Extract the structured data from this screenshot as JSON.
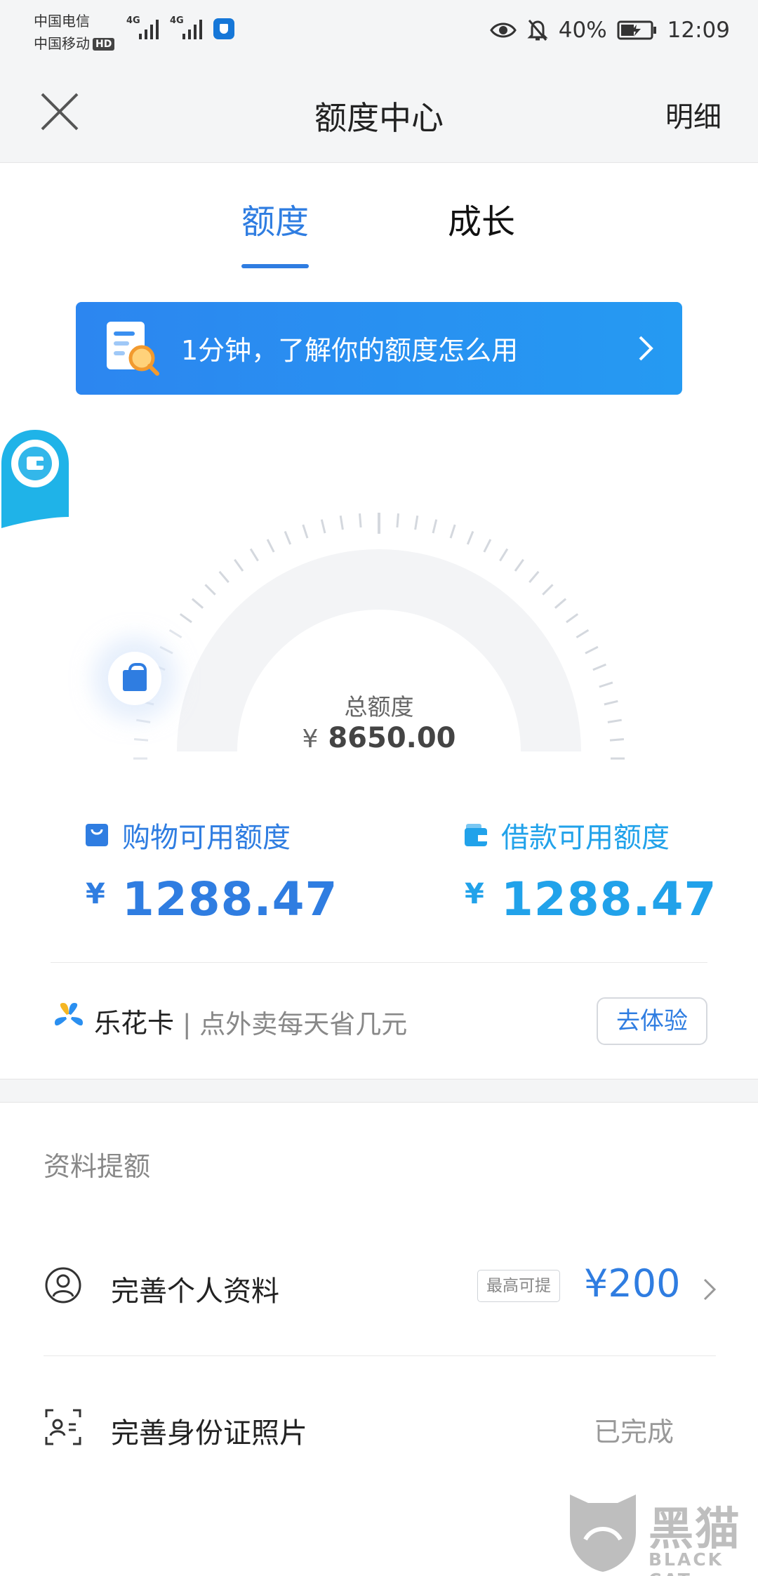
{
  "status_bar": {
    "carrier_1": "中国电信",
    "carrier_2": "中国移动",
    "hd": "HD",
    "network_1": "4G",
    "network_2": "4G",
    "battery": "40%",
    "time": "12:09"
  },
  "nav": {
    "title": "额度中心",
    "detail": "明细"
  },
  "tabs": [
    {
      "label": "额度",
      "active": true
    },
    {
      "label": "成长",
      "active": false
    }
  ],
  "banner": {
    "text": "1分钟，了解你的额度怎么用"
  },
  "gauge": {
    "label": "总额度",
    "currency": "¥",
    "total": "8650.00"
  },
  "available": {
    "shopping": {
      "label": "购物可用额度",
      "currency": "¥",
      "amount": "1288.47",
      "color": "#2f7de1"
    },
    "loan": {
      "label": "借款可用额度",
      "currency": "¥",
      "amount": "1288.47",
      "color": "#21a2ea"
    }
  },
  "promo": {
    "name": "乐花卡",
    "description": "| 点外卖每天省几元",
    "button": "去体验"
  },
  "section": {
    "title": "资料提额",
    "items": [
      {
        "label": "完善个人资料",
        "tag": "最高可提",
        "reward": "¥200",
        "icon": "user-icon"
      },
      {
        "label": "完善身份证照片",
        "status": "已完成",
        "icon": "id-card-icon"
      }
    ]
  },
  "watermark": {
    "text": "黑猫",
    "subtext": "BLACK CAT"
  },
  "colors": {
    "accent": "#2f7de1",
    "accent_light": "#21a2ea",
    "background_gray": "#f4f5f6"
  }
}
